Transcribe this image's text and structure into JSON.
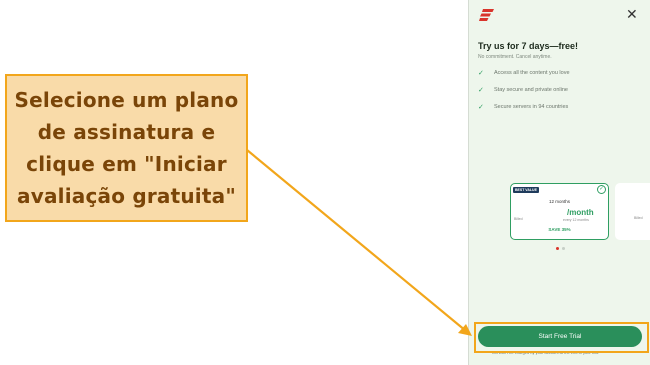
{
  "callout": {
    "lines": [
      "Selecione um plano",
      "de assinatura e",
      "clique em \"Iniciar",
      "avaliação gratuita\""
    ]
  },
  "panel": {
    "headline": "Try us for 7 days—free!",
    "subline": "No commitment. Cancel anytime.",
    "features": [
      {
        "icon": "check-icon",
        "label": "Access all the content you love"
      },
      {
        "icon": "check-icon",
        "label": "Stay secure and private online"
      },
      {
        "icon": "check-icon",
        "label": "Secure servers in 94 countries"
      }
    ],
    "plan": {
      "badge": "BEST VALUE",
      "term": "12 months",
      "price": "/month",
      "billed": "Billed",
      "every": "every 12 months",
      "save": "SAVE 35%"
    },
    "plan_2": {
      "billed": "Billed"
    },
    "cta_label": "Start Free Trial",
    "disclaimer": "You won't be charged by your account at the end of your trial"
  },
  "colors": {
    "accent": "#2a8f5b",
    "callout_bg": "#f9dba9",
    "callout_border": "#f2a61b",
    "callout_text": "#7a4508",
    "brand_red": "#d9342b"
  }
}
